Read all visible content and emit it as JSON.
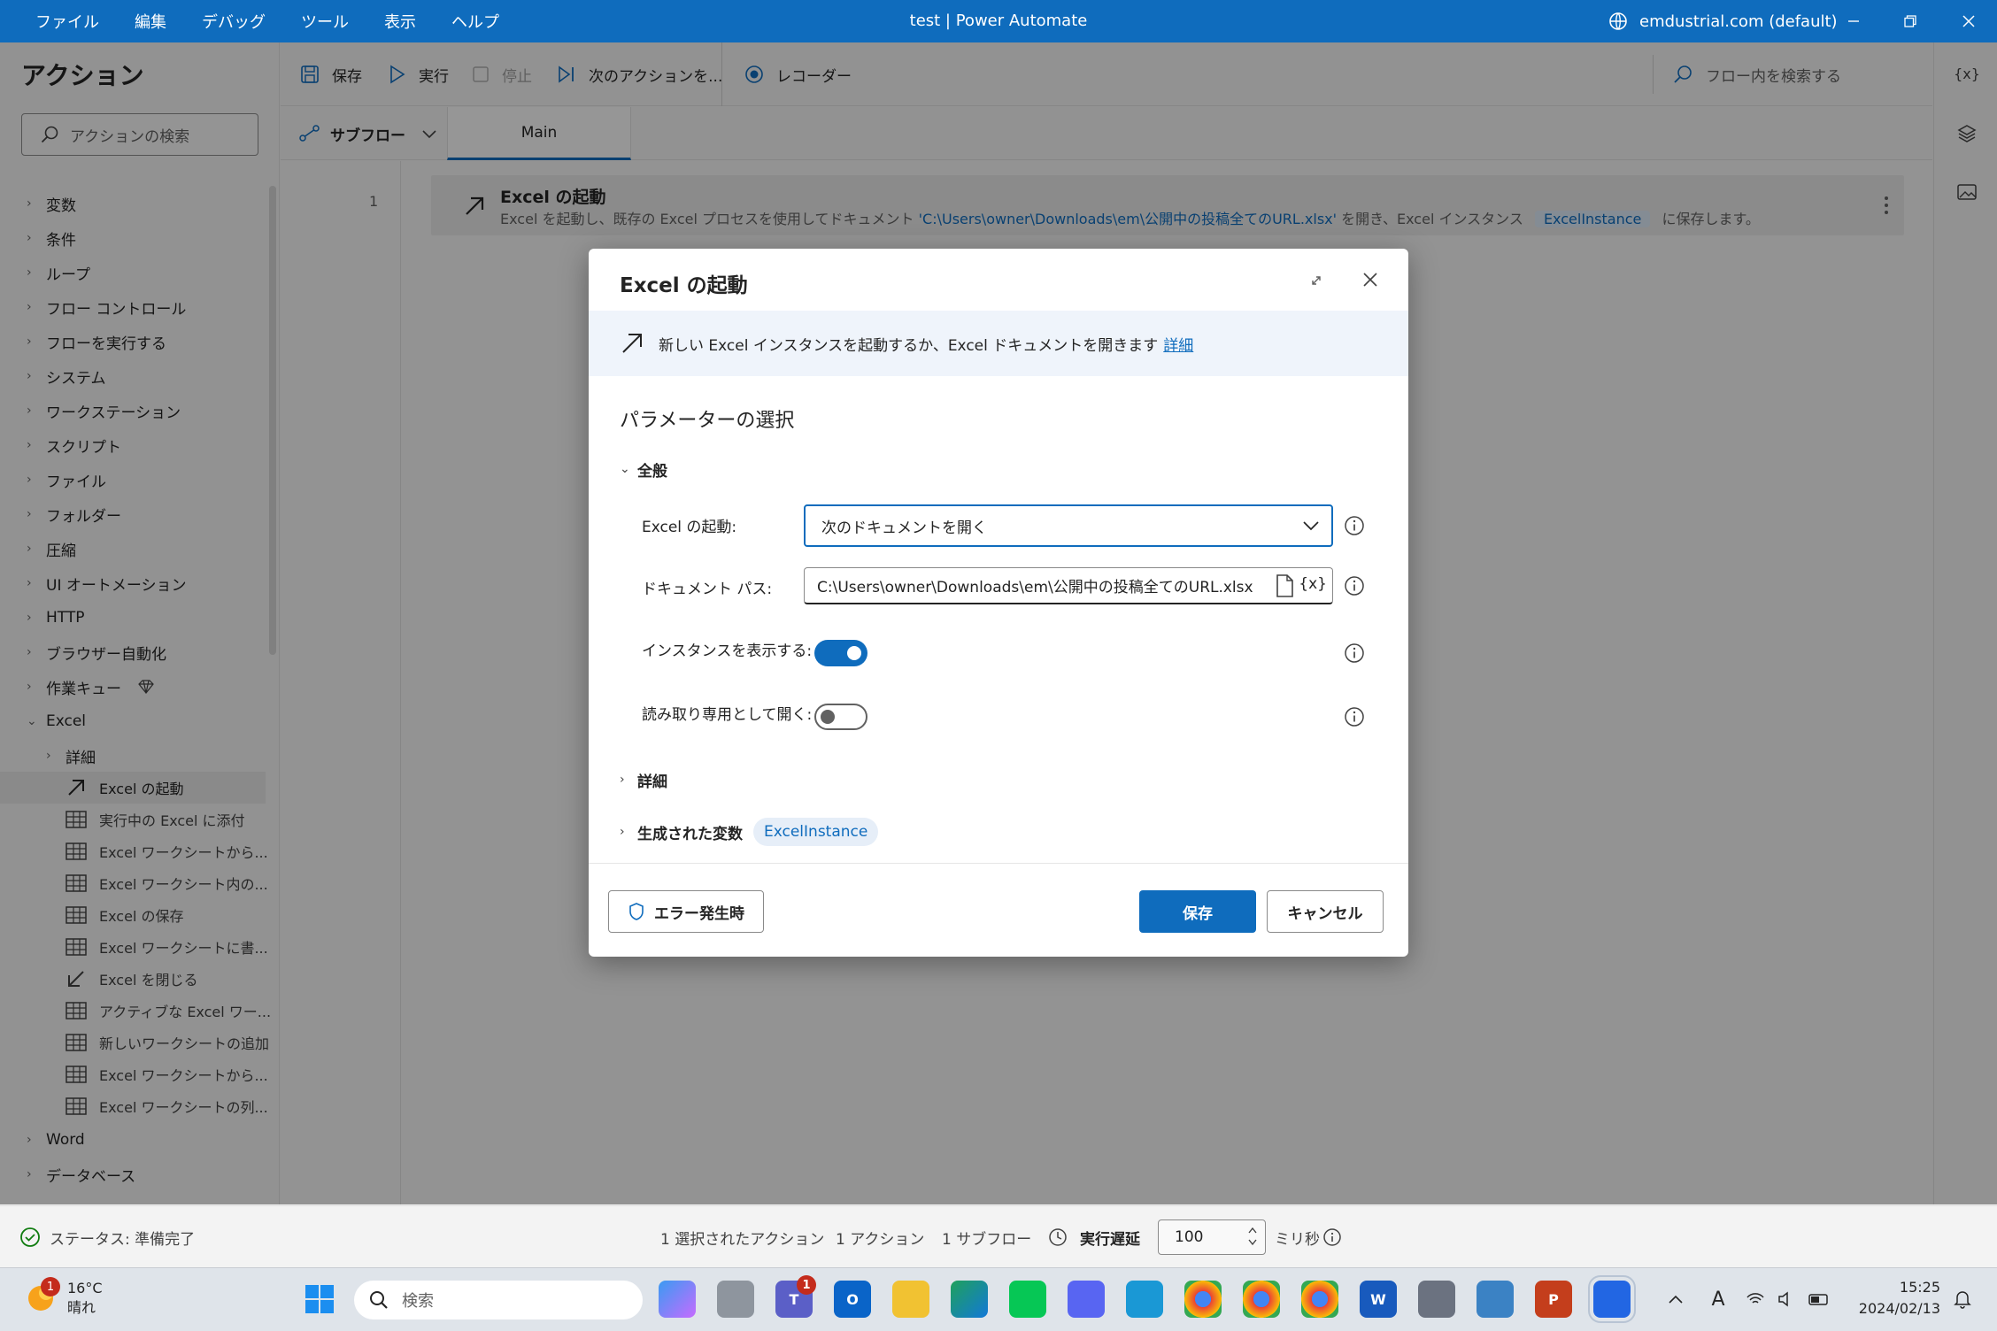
{
  "titlebar": {
    "menu": [
      "ファイル",
      "編集",
      "デバッグ",
      "ツール",
      "表示",
      "ヘルプ"
    ],
    "title": "test | Power Automate",
    "account": "emdustrial.com (default)"
  },
  "actions_pane": {
    "title": "アクション",
    "search_placeholder": "アクションの検索",
    "groups": [
      "変数",
      "条件",
      "ループ",
      "フロー コントロール",
      "フローを実行する",
      "システム",
      "ワークステーション",
      "スクリプト",
      "ファイル",
      "フォルダー",
      "圧縮",
      "UI オートメーション",
      "HTTP",
      "ブラウザー自動化",
      "作業キュー"
    ],
    "excel_group": "Excel",
    "excel_sub": "詳細",
    "excel_actions": [
      "Excel の起動",
      "実行中の Excel に添付",
      "Excel ワークシートから...",
      "Excel ワークシート内の...",
      "Excel の保存",
      "Excel ワークシートに書...",
      "Excel を閉じる",
      "アクティブな Excel ワー...",
      "新しいワークシートの追加",
      "Excel ワークシートから...",
      "Excel ワークシートの列..."
    ],
    "more_groups": [
      "Word",
      "データベース"
    ]
  },
  "toolbar": {
    "save": "保存",
    "run": "実行",
    "stop": "停止",
    "next": "次のアクションを...",
    "recorder": "レコーダー",
    "search_flow": "フロー内を検索する"
  },
  "tabs": {
    "subflow": "サブフロー",
    "main": "Main"
  },
  "flow_step": {
    "line": "1",
    "title": "Excel の起動",
    "desc_prefix": "Excel を起動し、既存の Excel プロセスを使用してドキュメント ",
    "desc_path": "'C:\\Users\\owner\\Downloads\\em\\公開中の投稿全てのURL.xlsx'",
    "desc_middle": " を開き、Excel インスタンス ",
    "desc_var": "ExcelInstance",
    "desc_suffix": " に保存します。"
  },
  "dialog": {
    "title": "Excel の起動",
    "info": "新しい Excel インスタンスを起動するか、Excel ドキュメントを開きます",
    "info_link": "詳細",
    "params_title": "パラメーターの選択",
    "general": "全般",
    "launch_label": "Excel の起動:",
    "launch_value": "次のドキュメントを開く",
    "path_label": "ドキュメント パス:",
    "path_value": "C:\\Users\\owner\\Downloads\\em\\公開中の投稿全てのURL.xlsx",
    "show_label": "インスタンスを表示する:",
    "show_on": true,
    "readonly_label": "読み取り専用として開く:",
    "readonly_on": false,
    "details": "詳細",
    "generated": "生成された変数",
    "generated_var": "ExcelInstance",
    "error_btn": "エラー発生時",
    "save_btn": "保存",
    "cancel_btn": "キャンセル",
    "var_glyph": "{x}"
  },
  "statusbar": {
    "status": "ステータス: 準備完了",
    "selected": "1 選択されたアクション",
    "actions": "1 アクション",
    "subflows": "1 サブフロー",
    "delay_label": "実行遅延",
    "delay_value": "100",
    "unit": "ミリ秒"
  },
  "taskbar": {
    "temp": "16°C",
    "weather": "晴れ",
    "weather_badge": "1",
    "search": "検索",
    "teams_badge": "1",
    "time": "15:25",
    "date": "2024/02/13"
  },
  "rail": {
    "variables": "{x}"
  },
  "colors": {
    "accent": "#0f6cbd",
    "titlebar": "#0f6cbd"
  }
}
